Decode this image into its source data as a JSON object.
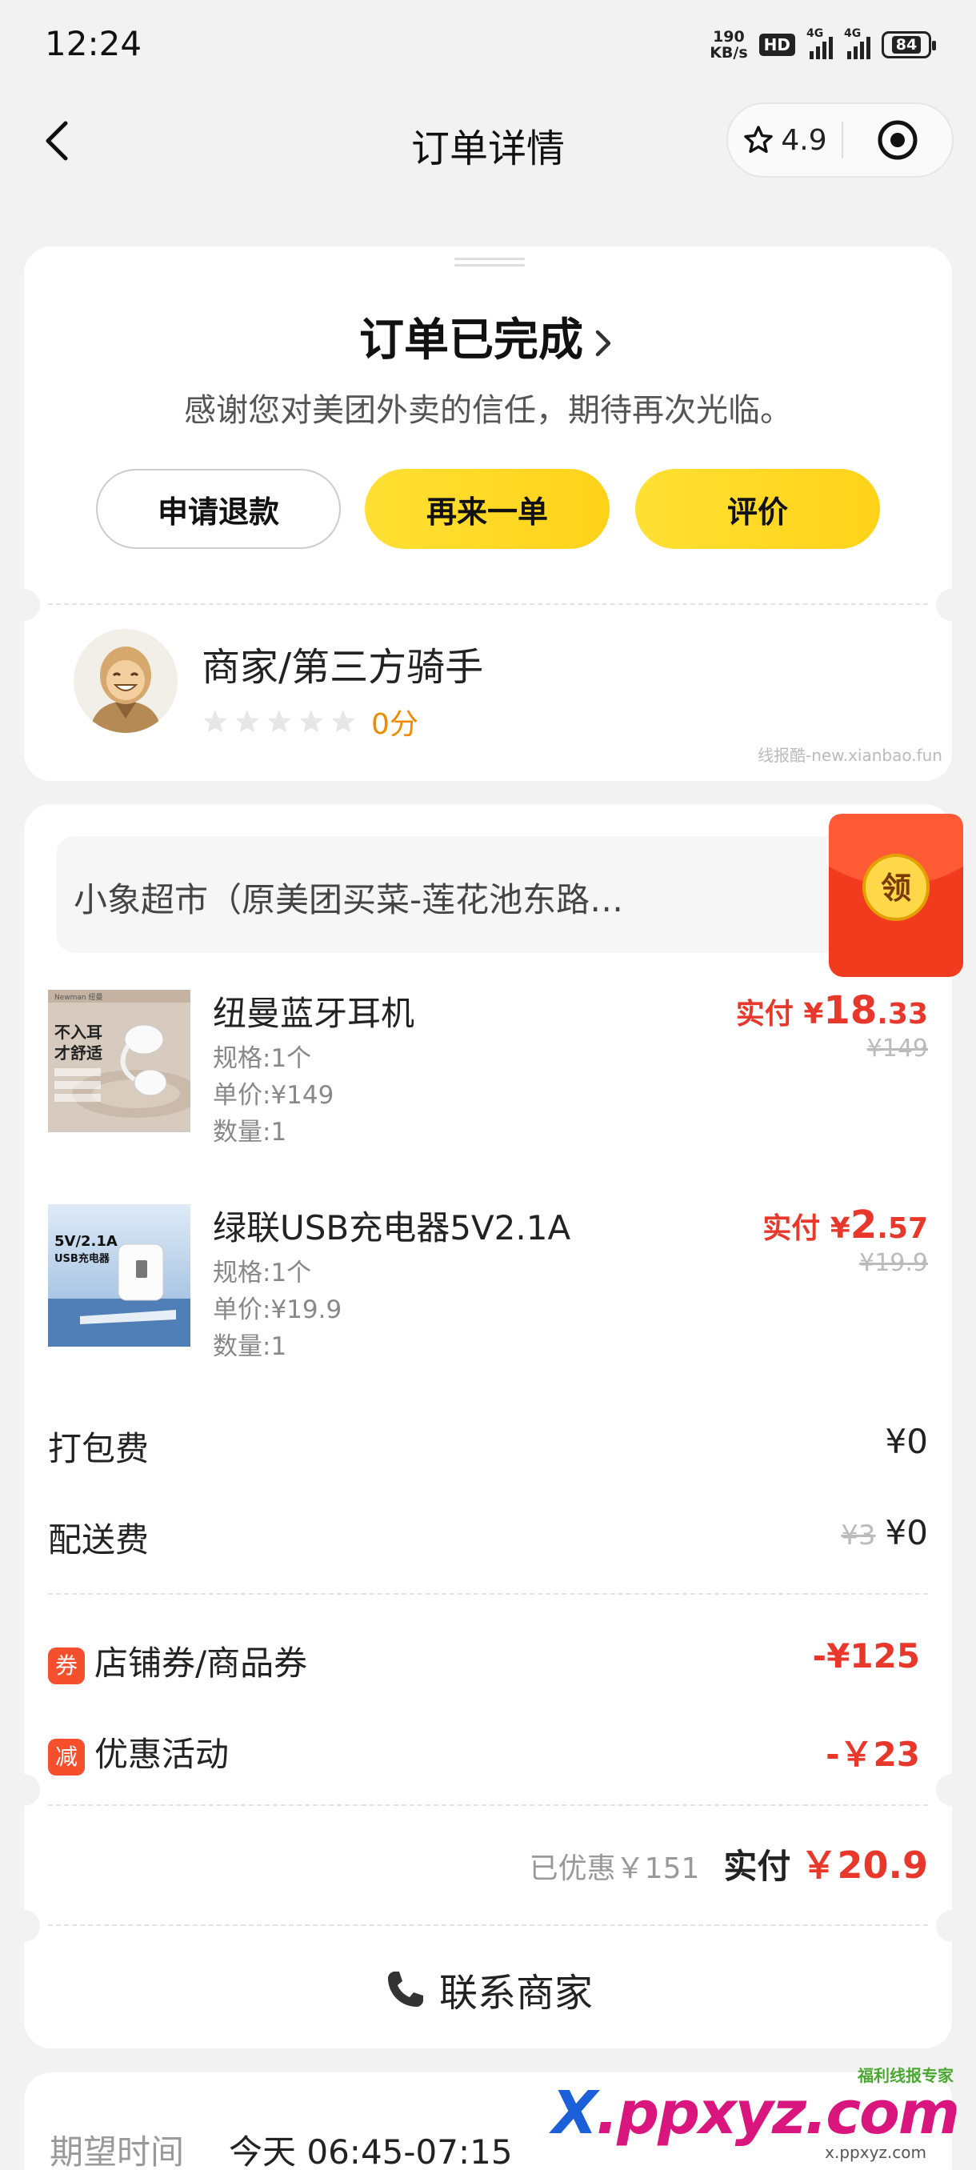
{
  "status_bar": {
    "time": "12:24",
    "net_speed_value": "190",
    "net_speed_unit": "KB/s",
    "hd": "HD",
    "signal1": "4G",
    "signal2": "4G",
    "battery": "84"
  },
  "nav": {
    "title": "订单详情",
    "rating": "4.9"
  },
  "status": {
    "title": "订单已完成",
    "subtitle": "感谢您对美团外卖的信任，期待再次光临。",
    "buttons": {
      "refund": "申请退款",
      "reorder": "再来一单",
      "review": "评价"
    }
  },
  "rider": {
    "name": "商家/第三方骑手",
    "stars": 0,
    "score": "0分",
    "watermark": "线报酷-new.xianbao.fun"
  },
  "shop": {
    "name": "小象超市（原美团买菜-莲花池东路…",
    "red_packet_label": "领"
  },
  "items": [
    {
      "name": "纽曼蓝牙耳机",
      "spec": "规格:1个",
      "unit_price": "单价:¥149",
      "qty": "数量:1",
      "paid_label": "实付",
      "paid_currency": "¥",
      "paid_int": "18",
      "paid_dec": ".33",
      "original": "¥149",
      "thumb_text1": "不入耳",
      "thumb_text2": "才舒适",
      "thumb_brand": "Newman 纽曼"
    },
    {
      "name": "绿联USB充电器5V2.1A",
      "spec": "规格:1个",
      "unit_price": "单价:¥19.9",
      "qty": "数量:1",
      "paid_label": "实付",
      "paid_currency": "¥",
      "paid_int": "2",
      "paid_dec": ".57",
      "original": "¥19.9",
      "thumb_text1": "5V/2.1A",
      "thumb_text2": "USB充电器"
    }
  ],
  "fees": {
    "packing_label": "打包费",
    "packing_value": "¥0",
    "delivery_label": "配送费",
    "delivery_original": "¥3",
    "delivery_value": "¥0"
  },
  "discounts": {
    "coupon_tag": "券",
    "coupon_label": "店铺券/商品券",
    "coupon_value": "-¥125",
    "promo_tag": "减",
    "promo_label": "优惠活动",
    "promo_value": "-￥23"
  },
  "summary": {
    "saved": "已优惠￥151",
    "paid_label": "实付",
    "paid_value": "￥20.9"
  },
  "contact": {
    "label": "联系商家"
  },
  "expected": {
    "label": "期望时间",
    "value": "今天 06:45-07:15"
  },
  "brand_watermark": {
    "small": "福利线报专家",
    "x": "X",
    "main": ".ppxyz.com",
    "url": "x.ppxyz.com"
  },
  "colors": {
    "accent_yellow": "#ffd21a",
    "price_red": "#e8372b",
    "score_orange": "#f08a00",
    "background": "#f2f2f2"
  },
  "icons": [
    "back-arrow-icon",
    "star-outline-icon",
    "target-icon",
    "chevron-right-icon",
    "red-packet-icon",
    "phone-icon"
  ]
}
